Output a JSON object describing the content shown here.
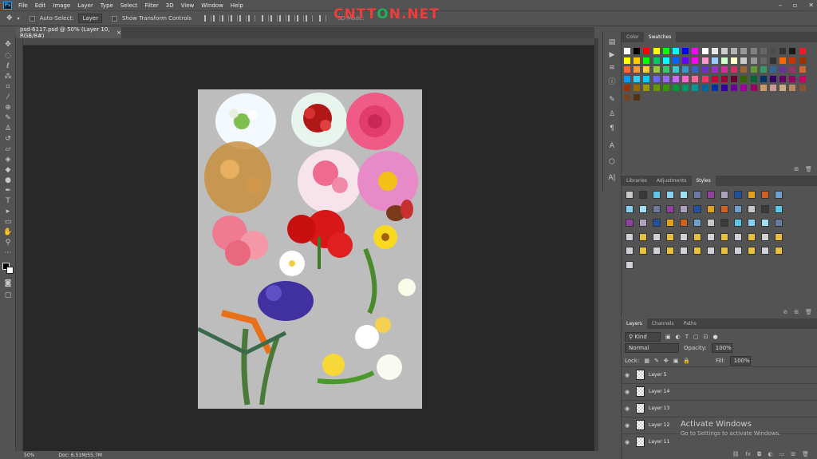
{
  "menu": {
    "app_logo": "Ps",
    "items": [
      "File",
      "Edit",
      "Image",
      "Layer",
      "Type",
      "Select",
      "Filter",
      "3D",
      "View",
      "Window",
      "Help"
    ]
  },
  "window_controls": [
    "search-icon",
    "minimize",
    "maximize",
    "close"
  ],
  "options": {
    "auto_select_label": "Auto-Select:",
    "auto_select_value": "Layer",
    "transform_label": "Show Transform Controls",
    "mode_label": "3D Mode:"
  },
  "watermark": {
    "part1": "CNTT",
    "part2": "O",
    "part3": "N.NET"
  },
  "document": {
    "tab_title": "psd-6117.psd @ 50% (Layer 10, RGB/8#)",
    "close": "×"
  },
  "status": {
    "zoom": "50%",
    "doc_size": "Doc: 6.51M/55.7M"
  },
  "color_panel": {
    "tabs": [
      "Color",
      "Swatches"
    ],
    "active": "Swatches"
  },
  "styles_panel": {
    "tabs": [
      "Libraries",
      "Adjustments",
      "Styles"
    ],
    "active": "Styles"
  },
  "layers_panel": {
    "tabs": [
      "Layers",
      "Channels",
      "Paths"
    ],
    "active": "Layers",
    "kind_label": "Kind",
    "blend_mode": "Normal",
    "opacity_label": "Opacity:",
    "opacity": "100%",
    "lock_label": "Lock:",
    "fill_label": "Fill:",
    "fill": "100%",
    "layers": [
      {
        "name": "Layer 5"
      },
      {
        "name": "Layer 14"
      },
      {
        "name": "Layer 13"
      },
      {
        "name": "Layer 12"
      },
      {
        "name": "Layer 11"
      }
    ]
  },
  "activation": {
    "title": "Activate Windows",
    "subtitle": "Go to Settings to activate Windows."
  },
  "swatch_colors": [
    "#ffffff",
    "#000000",
    "#ff0000",
    "#ffff00",
    "#00ff00",
    "#00ffff",
    "#0000ff",
    "#ff00ff",
    "#ffffff",
    "#e6e6e6",
    "#cccccc",
    "#b3b3b3",
    "#999999",
    "#808080",
    "#666666",
    "#4d4d4d",
    "#333333",
    "#1a1a1a",
    "#ed1c24"
  ]
}
